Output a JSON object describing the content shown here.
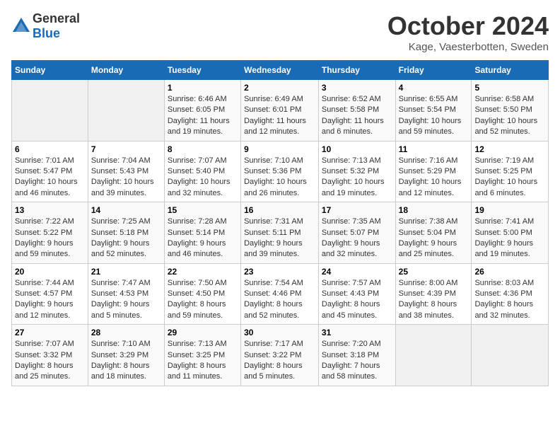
{
  "logo": {
    "general": "General",
    "blue": "Blue"
  },
  "title": "October 2024",
  "subtitle": "Kage, Vaesterbotten, Sweden",
  "headers": [
    "Sunday",
    "Monday",
    "Tuesday",
    "Wednesday",
    "Thursday",
    "Friday",
    "Saturday"
  ],
  "rows": [
    [
      {
        "day": "",
        "empty": true
      },
      {
        "day": "",
        "empty": true
      },
      {
        "day": "1",
        "sunrise": "Sunrise: 6:46 AM",
        "sunset": "Sunset: 6:05 PM",
        "daylight": "Daylight: 11 hours and 19 minutes."
      },
      {
        "day": "2",
        "sunrise": "Sunrise: 6:49 AM",
        "sunset": "Sunset: 6:01 PM",
        "daylight": "Daylight: 11 hours and 12 minutes."
      },
      {
        "day": "3",
        "sunrise": "Sunrise: 6:52 AM",
        "sunset": "Sunset: 5:58 PM",
        "daylight": "Daylight: 11 hours and 6 minutes."
      },
      {
        "day": "4",
        "sunrise": "Sunrise: 6:55 AM",
        "sunset": "Sunset: 5:54 PM",
        "daylight": "Daylight: 10 hours and 59 minutes."
      },
      {
        "day": "5",
        "sunrise": "Sunrise: 6:58 AM",
        "sunset": "Sunset: 5:50 PM",
        "daylight": "Daylight: 10 hours and 52 minutes."
      }
    ],
    [
      {
        "day": "6",
        "sunrise": "Sunrise: 7:01 AM",
        "sunset": "Sunset: 5:47 PM",
        "daylight": "Daylight: 10 hours and 46 minutes."
      },
      {
        "day": "7",
        "sunrise": "Sunrise: 7:04 AM",
        "sunset": "Sunset: 5:43 PM",
        "daylight": "Daylight: 10 hours and 39 minutes."
      },
      {
        "day": "8",
        "sunrise": "Sunrise: 7:07 AM",
        "sunset": "Sunset: 5:40 PM",
        "daylight": "Daylight: 10 hours and 32 minutes."
      },
      {
        "day": "9",
        "sunrise": "Sunrise: 7:10 AM",
        "sunset": "Sunset: 5:36 PM",
        "daylight": "Daylight: 10 hours and 26 minutes."
      },
      {
        "day": "10",
        "sunrise": "Sunrise: 7:13 AM",
        "sunset": "Sunset: 5:32 PM",
        "daylight": "Daylight: 10 hours and 19 minutes."
      },
      {
        "day": "11",
        "sunrise": "Sunrise: 7:16 AM",
        "sunset": "Sunset: 5:29 PM",
        "daylight": "Daylight: 10 hours and 12 minutes."
      },
      {
        "day": "12",
        "sunrise": "Sunrise: 7:19 AM",
        "sunset": "Sunset: 5:25 PM",
        "daylight": "Daylight: 10 hours and 6 minutes."
      }
    ],
    [
      {
        "day": "13",
        "sunrise": "Sunrise: 7:22 AM",
        "sunset": "Sunset: 5:22 PM",
        "daylight": "Daylight: 9 hours and 59 minutes."
      },
      {
        "day": "14",
        "sunrise": "Sunrise: 7:25 AM",
        "sunset": "Sunset: 5:18 PM",
        "daylight": "Daylight: 9 hours and 52 minutes."
      },
      {
        "day": "15",
        "sunrise": "Sunrise: 7:28 AM",
        "sunset": "Sunset: 5:14 PM",
        "daylight": "Daylight: 9 hours and 46 minutes."
      },
      {
        "day": "16",
        "sunrise": "Sunrise: 7:31 AM",
        "sunset": "Sunset: 5:11 PM",
        "daylight": "Daylight: 9 hours and 39 minutes."
      },
      {
        "day": "17",
        "sunrise": "Sunrise: 7:35 AM",
        "sunset": "Sunset: 5:07 PM",
        "daylight": "Daylight: 9 hours and 32 minutes."
      },
      {
        "day": "18",
        "sunrise": "Sunrise: 7:38 AM",
        "sunset": "Sunset: 5:04 PM",
        "daylight": "Daylight: 9 hours and 25 minutes."
      },
      {
        "day": "19",
        "sunrise": "Sunrise: 7:41 AM",
        "sunset": "Sunset: 5:00 PM",
        "daylight": "Daylight: 9 hours and 19 minutes."
      }
    ],
    [
      {
        "day": "20",
        "sunrise": "Sunrise: 7:44 AM",
        "sunset": "Sunset: 4:57 PM",
        "daylight": "Daylight: 9 hours and 12 minutes."
      },
      {
        "day": "21",
        "sunrise": "Sunrise: 7:47 AM",
        "sunset": "Sunset: 4:53 PM",
        "daylight": "Daylight: 9 hours and 5 minutes."
      },
      {
        "day": "22",
        "sunrise": "Sunrise: 7:50 AM",
        "sunset": "Sunset: 4:50 PM",
        "daylight": "Daylight: 8 hours and 59 minutes."
      },
      {
        "day": "23",
        "sunrise": "Sunrise: 7:54 AM",
        "sunset": "Sunset: 4:46 PM",
        "daylight": "Daylight: 8 hours and 52 minutes."
      },
      {
        "day": "24",
        "sunrise": "Sunrise: 7:57 AM",
        "sunset": "Sunset: 4:43 PM",
        "daylight": "Daylight: 8 hours and 45 minutes."
      },
      {
        "day": "25",
        "sunrise": "Sunrise: 8:00 AM",
        "sunset": "Sunset: 4:39 PM",
        "daylight": "Daylight: 8 hours and 38 minutes."
      },
      {
        "day": "26",
        "sunrise": "Sunrise: 8:03 AM",
        "sunset": "Sunset: 4:36 PM",
        "daylight": "Daylight: 8 hours and 32 minutes."
      }
    ],
    [
      {
        "day": "27",
        "sunrise": "Sunrise: 7:07 AM",
        "sunset": "Sunset: 3:32 PM",
        "daylight": "Daylight: 8 hours and 25 minutes."
      },
      {
        "day": "28",
        "sunrise": "Sunrise: 7:10 AM",
        "sunset": "Sunset: 3:29 PM",
        "daylight": "Daylight: 8 hours and 18 minutes."
      },
      {
        "day": "29",
        "sunrise": "Sunrise: 7:13 AM",
        "sunset": "Sunset: 3:25 PM",
        "daylight": "Daylight: 8 hours and 11 minutes."
      },
      {
        "day": "30",
        "sunrise": "Sunrise: 7:17 AM",
        "sunset": "Sunset: 3:22 PM",
        "daylight": "Daylight: 8 hours and 5 minutes."
      },
      {
        "day": "31",
        "sunrise": "Sunrise: 7:20 AM",
        "sunset": "Sunset: 3:18 PM",
        "daylight": "Daylight: 7 hours and 58 minutes."
      },
      {
        "day": "",
        "empty": true
      },
      {
        "day": "",
        "empty": true
      }
    ]
  ]
}
